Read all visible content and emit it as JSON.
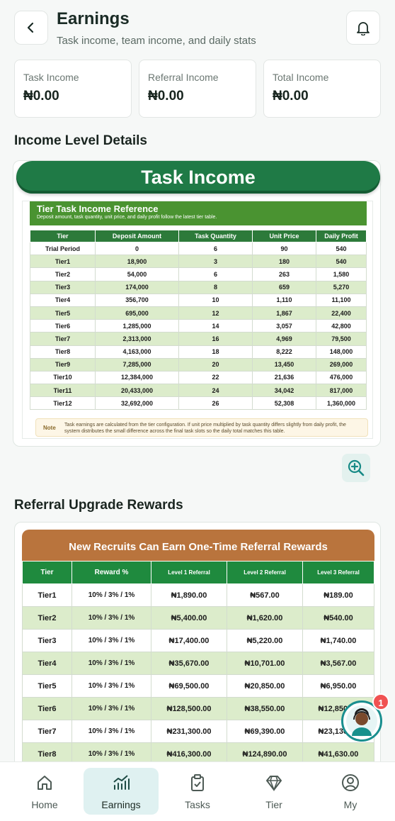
{
  "header": {
    "title": "Earnings",
    "subtitle": "Task income, team income, and daily stats"
  },
  "stats": [
    {
      "label": "Task Income",
      "value": "₦0.00"
    },
    {
      "label": "Referral Income",
      "value": "₦0.00"
    },
    {
      "label": "Total Income",
      "value": "₦0.00"
    }
  ],
  "sections": {
    "income_level": "Income Level Details",
    "referral": "Referral Upgrade Rewards"
  },
  "task_income": {
    "banner": "Task Income",
    "table_title": "Tier Task Income Reference",
    "table_subtitle": "Deposit amount, task quantity, unit price, and daily profit follow the latest tier table.",
    "headers": [
      "Tier",
      "Deposit Amount",
      "Task Quantity",
      "Unit Price",
      "Daily Profit"
    ],
    "rows": [
      [
        "Trial Period",
        "0",
        "6",
        "90",
        "540"
      ],
      [
        "Tier1",
        "18,900",
        "3",
        "180",
        "540"
      ],
      [
        "Tier2",
        "54,000",
        "6",
        "263",
        "1,580"
      ],
      [
        "Tier3",
        "174,000",
        "8",
        "659",
        "5,270"
      ],
      [
        "Tier4",
        "356,700",
        "10",
        "1,110",
        "11,100"
      ],
      [
        "Tier5",
        "695,000",
        "12",
        "1,867",
        "22,400"
      ],
      [
        "Tier6",
        "1,285,000",
        "14",
        "3,057",
        "42,800"
      ],
      [
        "Tier7",
        "2,313,000",
        "16",
        "4,969",
        "79,500"
      ],
      [
        "Tier8",
        "4,163,000",
        "18",
        "8,222",
        "148,000"
      ],
      [
        "Tier9",
        "7,285,000",
        "20",
        "13,450",
        "269,000"
      ],
      [
        "Tier10",
        "12,384,000",
        "22",
        "21,636",
        "476,000"
      ],
      [
        "Tier11",
        "20,433,000",
        "24",
        "34,042",
        "817,000"
      ],
      [
        "Tier12",
        "32,692,000",
        "26",
        "52,308",
        "1,360,000"
      ]
    ],
    "note_tag": "Note",
    "note": "Task earnings are calculated from the tier configuration. If unit price multiplied by task quantity differs slightly from daily profit, the system distributes the small difference across the final task slots so the daily total matches this table."
  },
  "referral": {
    "banner": "New Recruits Can Earn One-Time Referral Rewards",
    "headers": [
      "Tier",
      "Reward %",
      "Level 1 Referral",
      "Level 2 Referral",
      "Level 3 Referral"
    ],
    "rows": [
      [
        "Tier1",
        "10% / 3% / 1%",
        "₦1,890.00",
        "₦567.00",
        "₦189.00"
      ],
      [
        "Tier2",
        "10% / 3% / 1%",
        "₦5,400.00",
        "₦1,620.00",
        "₦540.00"
      ],
      [
        "Tier3",
        "10% / 3% / 1%",
        "₦17,400.00",
        "₦5,220.00",
        "₦1,740.00"
      ],
      [
        "Tier4",
        "10% / 3% / 1%",
        "₦35,670.00",
        "₦10,701.00",
        "₦3,567.00"
      ],
      [
        "Tier5",
        "10% / 3% / 1%",
        "₦69,500.00",
        "₦20,850.00",
        "₦6,950.00"
      ],
      [
        "Tier6",
        "10% / 3% / 1%",
        "₦128,500.00",
        "₦38,550.00",
        "₦12,850.00"
      ],
      [
        "Tier7",
        "10% / 3% / 1%",
        "₦231,300.00",
        "₦69,390.00",
        "₦23,130.00"
      ],
      [
        "Tier8",
        "10% / 3% / 1%",
        "₦416,300.00",
        "₦124,890.00",
        "₦41,630.00"
      ]
    ]
  },
  "nav": [
    {
      "label": "Home",
      "icon": "home-icon"
    },
    {
      "label": "Earnings",
      "icon": "chart-icon",
      "active": true
    },
    {
      "label": "Tasks",
      "icon": "clipboard-icon"
    },
    {
      "label": "Tier",
      "icon": "diamond-icon"
    },
    {
      "label": "My",
      "icon": "user-icon"
    }
  ],
  "chat": {
    "badge": "1"
  }
}
